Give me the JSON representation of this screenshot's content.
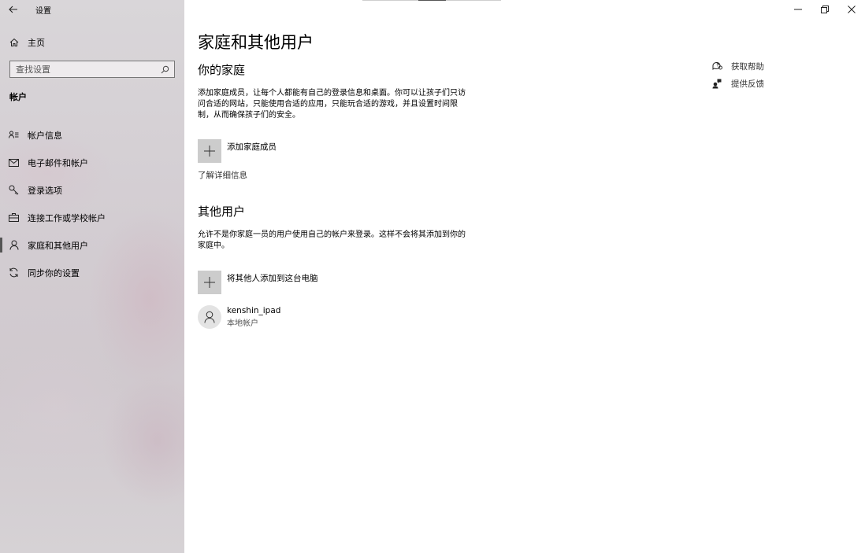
{
  "window": {
    "title": "设置"
  },
  "sidebar": {
    "home_label": "主页",
    "search_placeholder": "查找设置",
    "section_heading": "帐户",
    "items": [
      {
        "label": "帐户信息",
        "icon": "person-card-icon"
      },
      {
        "label": "电子邮件和帐户",
        "icon": "mail-icon"
      },
      {
        "label": "登录选项",
        "icon": "key-icon"
      },
      {
        "label": "连接工作或学校帐户",
        "icon": "briefcase-icon"
      },
      {
        "label": "家庭和其他用户",
        "icon": "person-icon",
        "selected": true
      },
      {
        "label": "同步你的设置",
        "icon": "sync-icon"
      }
    ]
  },
  "main": {
    "page_title": "家庭和其他用户",
    "family": {
      "heading": "你的家庭",
      "description": "添加家庭成员，让每个人都能有自己的登录信息和桌面。你可以让孩子们只访问合适的网站，只能使用合适的应用，只能玩合适的游戏，并且设置时间限制，从而确保孩子们的安全。",
      "add_label": "添加家庭成员",
      "learn_more": "了解详细信息"
    },
    "others": {
      "heading": "其他用户",
      "description": "允许不是你家庭一员的用户使用自己的帐户来登录。这样不会将其添加到你的家庭中。",
      "add_label": "将其他人添加到这台电脑",
      "users": [
        {
          "name": "kenshin_ipad",
          "type": "本地帐户"
        }
      ]
    }
  },
  "help": {
    "get_help": "获取帮助",
    "feedback": "提供反馈"
  },
  "colors": {
    "tile_gray": "#cccccc",
    "selected_indicator": "#555555"
  }
}
